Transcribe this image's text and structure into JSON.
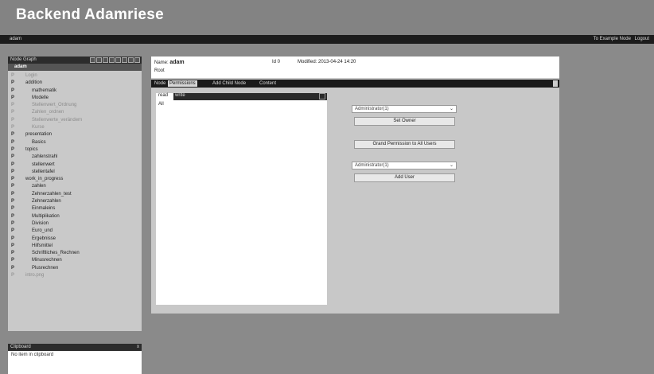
{
  "app": {
    "title": "Backend Adamriese"
  },
  "topbar": {
    "user": "adam",
    "links": [
      "To Example Node",
      "Logout"
    ]
  },
  "tree": {
    "header": "Node Graph",
    "root": "adam",
    "items": [
      {
        "label": "Login",
        "indent": 1,
        "dim": true
      },
      {
        "label": "addition",
        "indent": 1,
        "dim": false
      },
      {
        "label": "mathematik",
        "indent": 2,
        "dim": false
      },
      {
        "label": "Modelle",
        "indent": 2,
        "dim": false
      },
      {
        "label": "Stellenwert_Ordnung",
        "indent": 2,
        "dim": true
      },
      {
        "label": "Zahlen_ordnen",
        "indent": 2,
        "dim": true
      },
      {
        "label": "Stellenwerte_verändern",
        "indent": 2,
        "dim": true
      },
      {
        "label": "Kurse",
        "indent": 2,
        "dim": true
      },
      {
        "label": "presentation",
        "indent": 1,
        "dim": false
      },
      {
        "label": "Basics",
        "indent": 2,
        "dim": false
      },
      {
        "label": "topics",
        "indent": 1,
        "dim": false
      },
      {
        "label": "zahlenstrahl",
        "indent": 2,
        "dim": false
      },
      {
        "label": "stellenwert",
        "indent": 2,
        "dim": false
      },
      {
        "label": "stellentafel",
        "indent": 2,
        "dim": false
      },
      {
        "label": "work_in_progress",
        "indent": 1,
        "dim": false
      },
      {
        "label": "zahlen",
        "indent": 2,
        "dim": false
      },
      {
        "label": "Zehnerzahlen_test",
        "indent": 2,
        "dim": false
      },
      {
        "label": "Zehnerzahlen",
        "indent": 2,
        "dim": false
      },
      {
        "label": "Einmaleins",
        "indent": 2,
        "dim": false
      },
      {
        "label": "Multiplikation",
        "indent": 2,
        "dim": false
      },
      {
        "label": "Division",
        "indent": 2,
        "dim": false
      },
      {
        "label": "Euro_und",
        "indent": 2,
        "dim": false
      },
      {
        "label": "Ergebnisse",
        "indent": 2,
        "dim": false
      },
      {
        "label": "Hilfsmittel",
        "indent": 2,
        "dim": false
      },
      {
        "label": "Schriftliches_Rechnen",
        "indent": 2,
        "dim": false
      },
      {
        "label": "Minusrechnen",
        "indent": 2,
        "dim": false
      },
      {
        "label": "Plusrechnen",
        "indent": 2,
        "dim": false
      },
      {
        "label": "intro.png",
        "indent": 1,
        "dim": true
      }
    ]
  },
  "clipboard": {
    "header": "Clipboard",
    "close": "x",
    "text": "No item in clipboard"
  },
  "node": {
    "name_label": "Name:",
    "name_value": "adam",
    "type": "Root",
    "id": "Id 0",
    "modified": "Modified: 2013-04-24 14:20"
  },
  "tabs": [
    {
      "label": "Node",
      "active": false
    },
    {
      "label": "Permissions",
      "active": true
    },
    {
      "label": "Add Child Node",
      "active": false
    },
    {
      "label": "Content",
      "active": false
    }
  ],
  "permissions": {
    "read_header": "read",
    "write_header": "write",
    "row": "All",
    "owner_select": "Administrator(1)",
    "set_owner_button": "Set Owner",
    "grant_button": "Grand Permission to All Users",
    "user_select": "Administrator(1)",
    "add_user_button": "Add User"
  }
}
